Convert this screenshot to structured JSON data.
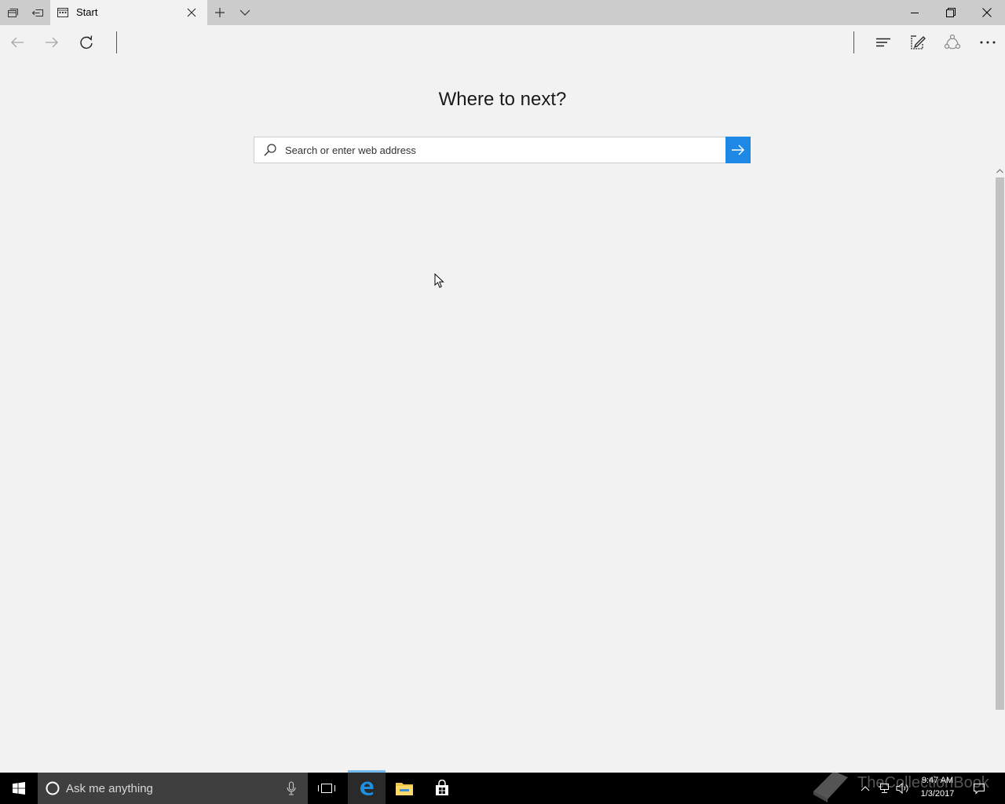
{
  "browser": {
    "tab": {
      "title": "Start"
    },
    "new_tab_label": "+",
    "page": {
      "heading": "Where to next?",
      "search": {
        "placeholder": "Search or enter web address",
        "value": ""
      }
    }
  },
  "taskbar": {
    "search_placeholder": "Ask me anything",
    "clock": {
      "time": "9:47 AM",
      "date": "1/3/2017"
    },
    "watermark": "TheCollectionBook"
  },
  "icons": [
    "tabs-aside-icon",
    "set-aside-tabs-icon",
    "tab-page-icon",
    "close-icon",
    "new-tab-icon",
    "chevron-down-icon",
    "minimize-icon",
    "restore-icon",
    "window-close-icon",
    "back-icon",
    "forward-icon",
    "refresh-icon",
    "hub-icon",
    "web-note-icon",
    "share-icon",
    "more-icon",
    "search-icon",
    "go-arrow-icon",
    "windows-start-icon",
    "cortana-circle-icon",
    "microphone-icon",
    "task-view-icon",
    "edge-icon",
    "file-explorer-icon",
    "store-icon",
    "chevron-up-icon",
    "network-icon",
    "volume-icon",
    "action-center-icon",
    "book-icon"
  ],
  "colors": {
    "accent": "#1e88e5",
    "page_background": "#f2f2f2",
    "titlebar": "#cccccc",
    "taskbar": "#000000",
    "cortana_box": "#3f3f3f"
  }
}
